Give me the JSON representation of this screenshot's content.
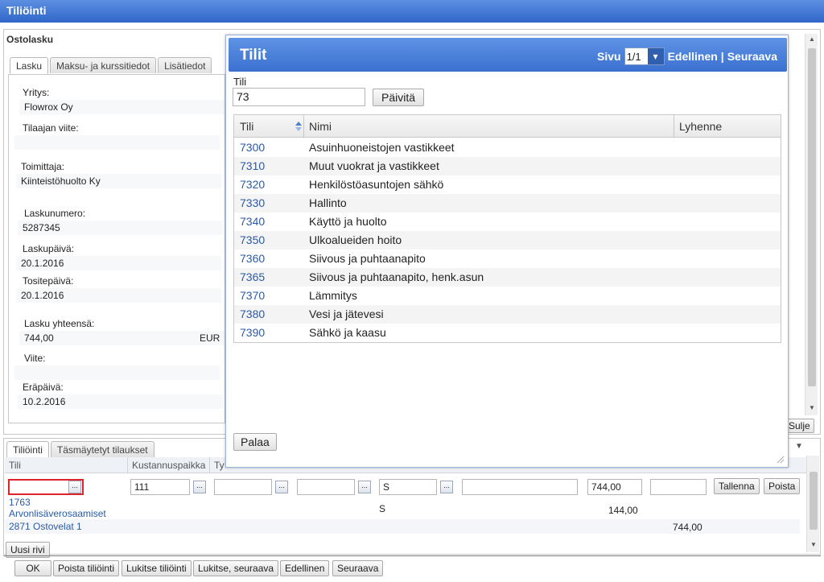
{
  "window": {
    "title": "Tiliöinti"
  },
  "invoice": {
    "heading": "Ostolasku",
    "tabs": [
      "Lasku",
      "Maksu- ja kurssitiedot",
      "Lisätiedot"
    ],
    "fields": {
      "yritys_label": "Yritys:",
      "yritys_value": "Flowrox Oy",
      "tilaajan_viite_label": "Tilaajan viite:",
      "tilaajan_viite_value": "",
      "toimittaja_label": "Toimittaja:",
      "toimittaja_value": "Kiinteistöhuolto Ky",
      "laskunumero_label": "Laskunumero:",
      "laskunumero_value": "5287345",
      "laskupaiva_label": "Laskupäivä:",
      "laskupaiva_value": "20.1.2016",
      "tositepaiva_label": "Tositepäivä:",
      "tositepaiva_value": "20.1.2016",
      "lasku_yhteensa_label": "Lasku yhteensä:",
      "lasku_yhteensa_value": "744,00",
      "currency": "EUR",
      "viite_label": "Viite:",
      "viite_value": "",
      "erapaiva_label": "Eräpäivä:",
      "erapaiva_value": "10.2.2016"
    },
    "sulje_label": "Sulje"
  },
  "posting": {
    "tabs": [
      "Tiliöinti",
      "Täsmäytetyt tilaukset"
    ],
    "columns": [
      "Tili",
      "Kustannuspaikka",
      "Ty"
    ],
    "row_inputs": {
      "tili": "",
      "kustannuspaikka": "111",
      "ty": "",
      "c4": "",
      "c5": "S",
      "c6": "",
      "amount": "744,00",
      "c8": ""
    },
    "tallenna_label": "Tallenna",
    "poista_label": "Poista",
    "entries": [
      {
        "account": "1763",
        "name": "Arvonlisäverosaamiset",
        "code": "S",
        "debit": "144,00",
        "credit": ""
      },
      {
        "account": "2871 Ostovelat 1",
        "name": "",
        "code": "",
        "debit": "",
        "credit": "744,00"
      }
    ],
    "uusi_rivi_label": "Uusi rivi",
    "dots_label": "..."
  },
  "footer_buttons": [
    "OK",
    "Poista tiliöinti",
    "Lukitse tiliöinti",
    "Lukitse, seuraava",
    "Edellinen",
    "Seuraava"
  ],
  "modal": {
    "title": "Tilit",
    "page_label": "Sivu",
    "page_value": "1/1",
    "prev_label": "Edellinen",
    "separator": "|",
    "next_label": "Seuraava",
    "search_label": "Tili",
    "search_value": "73",
    "refresh_label": "Päivitä",
    "columns": {
      "tili": "Tili",
      "nimi": "Nimi",
      "lyhenne": "Lyhenne"
    },
    "rows": [
      {
        "code": "7300",
        "name": "Asuinhuoneistojen vastikkeet"
      },
      {
        "code": "7310",
        "name": "Muut vuokrat ja vastikkeet"
      },
      {
        "code": "7320",
        "name": "Henkilöstöasuntojen sähkö"
      },
      {
        "code": "7330",
        "name": "Hallinto"
      },
      {
        "code": "7340",
        "name": "Käyttö ja huolto"
      },
      {
        "code": "7350",
        "name": "Ulkoalueiden hoito"
      },
      {
        "code": "7360",
        "name": "Siivous ja puhtaanapito"
      },
      {
        "code": "7365",
        "name": "Siivous ja puhtaanapito, henk.asun"
      },
      {
        "code": "7370",
        "name": "Lämmitys"
      },
      {
        "code": "7380",
        "name": "Vesi ja jätevesi"
      },
      {
        "code": "7390",
        "name": "Sähkö ja kaasu"
      }
    ],
    "back_label": "Palaa"
  }
}
